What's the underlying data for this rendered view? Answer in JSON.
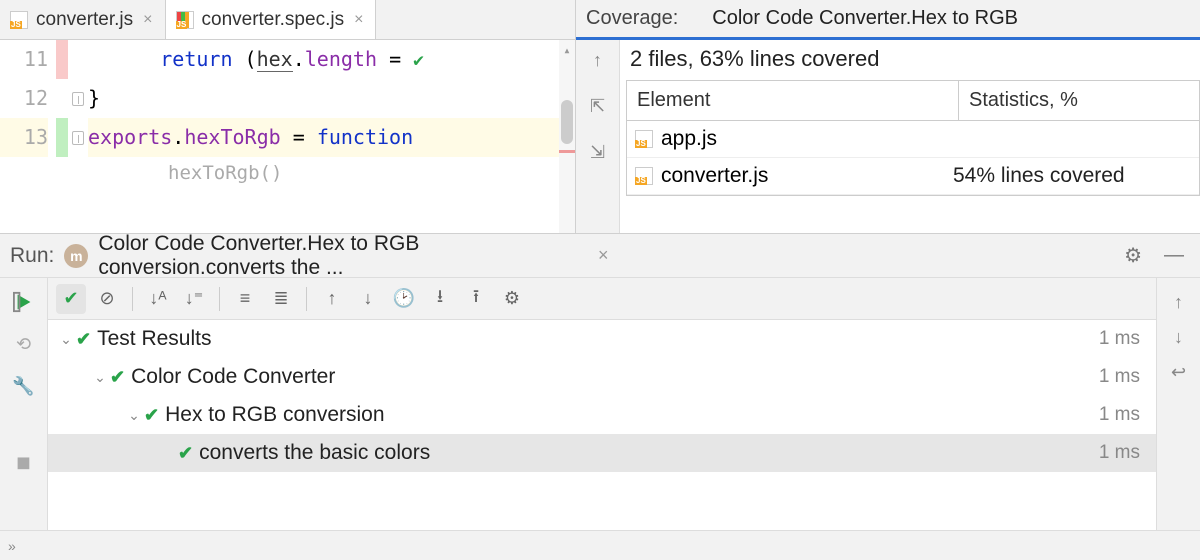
{
  "tabs": [
    {
      "label": "converter.js",
      "active": false
    },
    {
      "label": "converter.spec.js",
      "active": true
    }
  ],
  "editor": {
    "lines": [
      "11",
      "12",
      "13"
    ],
    "line11": {
      "return": "return",
      "hex": "hex",
      "length": "length",
      "eq": "="
    },
    "line12": {
      "brace": "}"
    },
    "line13": {
      "exports": "exports",
      "hexToRgb": "hexToRgb",
      "eq": "=",
      "function": "function"
    },
    "hint": "hexToRgb()"
  },
  "coverage": {
    "title": "Coverage:",
    "name": "Color Code Converter.Hex to RGB",
    "summary": "2 files, 63% lines covered",
    "columns": {
      "element": "Element",
      "stats": "Statistics, %"
    },
    "rows": [
      {
        "file": "app.js",
        "stats": ""
      },
      {
        "file": "converter.js",
        "stats": "54% lines covered"
      }
    ]
  },
  "run": {
    "label": "Run:",
    "title": "Color Code Converter.Hex to RGB conversion.converts the ..."
  },
  "tree": [
    {
      "indent": 0,
      "label": "Test Results",
      "time": "1 ms",
      "expandable": true
    },
    {
      "indent": 1,
      "label": "Color Code Converter",
      "time": "1 ms",
      "expandable": true
    },
    {
      "indent": 2,
      "label": "Hex to RGB conversion",
      "time": "1 ms",
      "expandable": true
    },
    {
      "indent": 3,
      "label": "converts the basic colors",
      "time": "1 ms",
      "expandable": false,
      "selected": true
    }
  ]
}
